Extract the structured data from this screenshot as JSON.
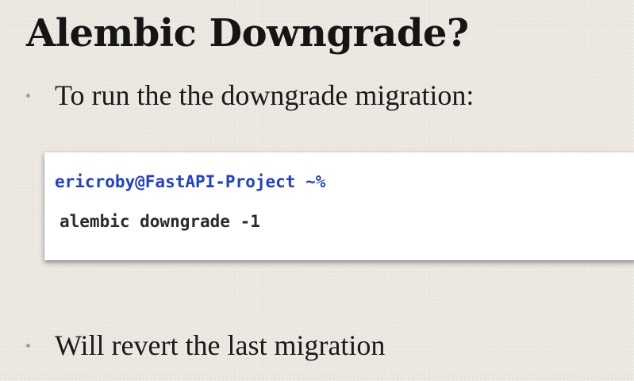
{
  "slide": {
    "title": "Alembic Downgrade?",
    "bullets": [
      {
        "text": "To run the the downgrade migration:"
      },
      {
        "text": "Will revert the last migration"
      }
    ],
    "terminal": {
      "prompt": "ericroby@FastAPI-Project ~%",
      "command": "alembic downgrade -1"
    },
    "colors": {
      "background": "#ece8e1",
      "prompt": "#1f3fd0",
      "command": "#2a2a2a",
      "bullet_dot": "#9aa0a8"
    }
  }
}
